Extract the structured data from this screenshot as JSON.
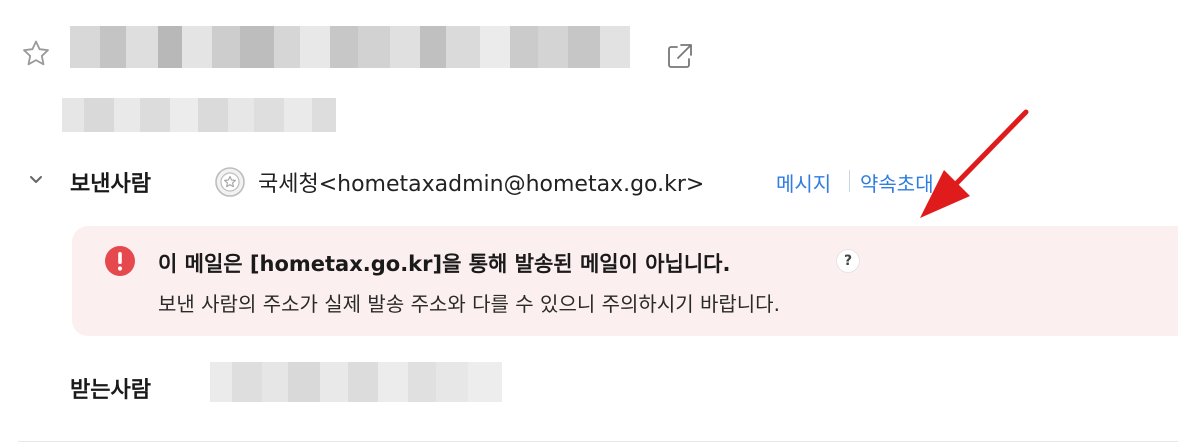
{
  "header": {
    "star_icon": "star-outline-icon",
    "external_icon": "open-in-new-window-icon"
  },
  "sender": {
    "label": "보낸사람",
    "address": "국세청<hometaxadmin@hometax.go.kr>",
    "actions": [
      "메시지",
      "약속초대"
    ],
    "icon": "sender-profile-icon"
  },
  "warning": {
    "title": "이 메일은 [hometax.go.kr]을 통해 발송된 메일이 아닙니다.",
    "help": "?",
    "description": "보낸 사람의 주소가 실제 발송 주소와 다를 수 있으니 주의하시기 바랍니다.",
    "icon": "exclamation-circle-icon",
    "accent_color": "#e5484d",
    "background_color": "#fcefef"
  },
  "recipient": {
    "label": "받는사람"
  },
  "annotation": {
    "arrow_color": "#e01b1b"
  },
  "colors": {
    "link": "#2f7de1"
  }
}
